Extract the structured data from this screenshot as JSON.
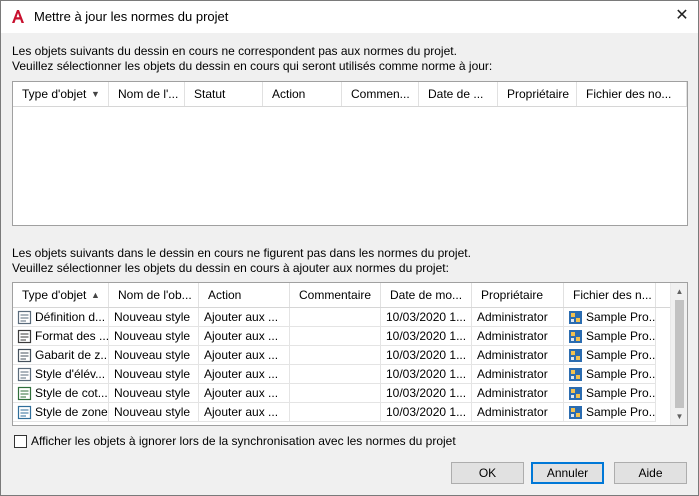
{
  "dialog": {
    "title": "Mettre à jour les normes du projet",
    "close_glyph": "✕",
    "app_icon": "autocad-a-icon",
    "accent_color": "#c8102e"
  },
  "section1": {
    "line1": "Les objets suivants du dessin en cours ne correspondent pas aux normes du projet.",
    "line2": "Veuillez sélectionner les objets du dessin en cours qui seront utilisés comme norme à jour:",
    "columns": [
      "Type d'objet",
      "Nom de l'...",
      "Statut",
      "Action",
      "Commen...",
      "Date de ...",
      "Propriétaire",
      "Fichier des no..."
    ],
    "sorted_column": "Type d'objet",
    "sort_direction": "descending",
    "rows": []
  },
  "section2": {
    "line1": "Les objets suivants dans le dessin en cours ne figurent pas dans les normes du projet.",
    "line2": "Veuillez sélectionner les objets du dessin en cours à ajouter aux normes du projet:",
    "columns": [
      "Type d'objet",
      "Nom de l'ob...",
      "Action",
      "Commentaire",
      "Date de mo...",
      "Propriétaire",
      "Fichier des n..."
    ],
    "sorted_column": "Type d'objet",
    "sort_direction": "ascending",
    "rows": [
      {
        "icon": "definition-icon",
        "type": "Définition d...",
        "name": "Nouveau style",
        "action": "Ajouter aux ...",
        "comment": "",
        "date": "10/03/2020 1...",
        "owner": "Administrator",
        "file": "Sample Pro..."
      },
      {
        "icon": "text-format-icon",
        "type": "Format des ...",
        "name": "Nouveau style",
        "action": "Ajouter aux ...",
        "comment": "",
        "date": "10/03/2020 1...",
        "owner": "Administrator",
        "file": "Sample Pro..."
      },
      {
        "icon": "template-icon",
        "type": "Gabarit de z...",
        "name": "Nouveau style",
        "action": "Ajouter aux ...",
        "comment": "",
        "date": "10/03/2020 1...",
        "owner": "Administrator",
        "file": "Sample Pro..."
      },
      {
        "icon": "elevation-style-icon",
        "type": "Style d'élév...",
        "name": "Nouveau style",
        "action": "Ajouter aux ...",
        "comment": "",
        "date": "10/03/2020 1...",
        "owner": "Administrator",
        "file": "Sample Pro..."
      },
      {
        "icon": "dimension-style-icon",
        "type": "Style de cot...",
        "name": "Nouveau style",
        "action": "Ajouter aux ...",
        "comment": "",
        "date": "10/03/2020 1...",
        "owner": "Administrator",
        "file": "Sample Pro..."
      },
      {
        "icon": "zone-style-icon",
        "type": "Style de zone",
        "name": "Nouveau style",
        "action": "Ajouter aux ...",
        "comment": "",
        "date": "10/03/2020 1...",
        "owner": "Administrator",
        "file": "Sample Pro..."
      }
    ]
  },
  "footer": {
    "checkbox_label": "Afficher les objets à ignorer lors de la synchronisation avec les normes du projet",
    "checkbox_checked": false,
    "ok_label": "OK",
    "cancel_label": "Annuler",
    "help_label": "Aide"
  }
}
